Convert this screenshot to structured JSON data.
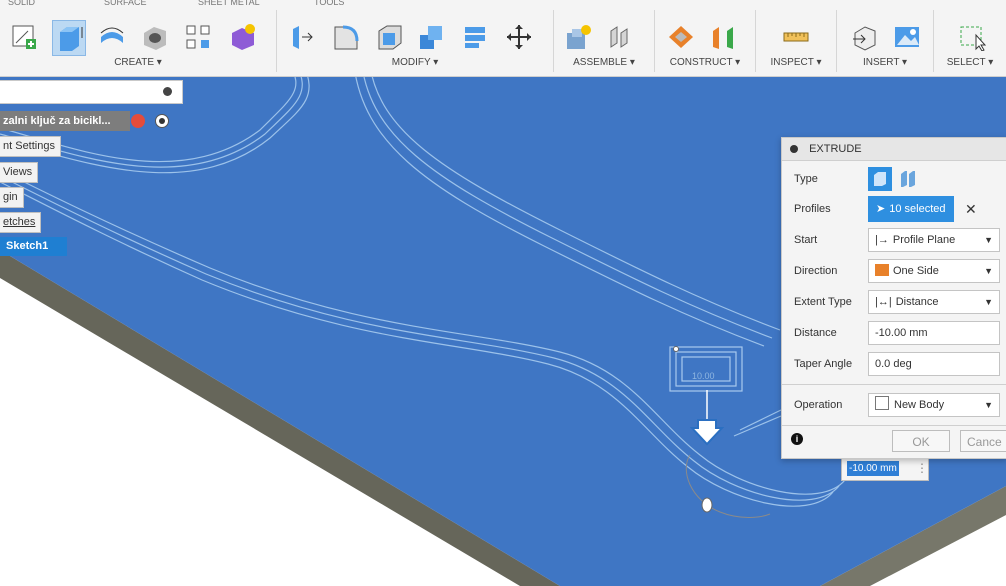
{
  "toolbar": {
    "tabs": [
      "SOLID",
      "SURFACE",
      "SHEET METAL",
      "TOOLS"
    ],
    "groups": {
      "create": "CREATE ▾",
      "modify": "MODIFY ▾",
      "assemble": "ASSEMBLE ▾",
      "construct": "CONSTRUCT ▾",
      "inspect": "INSPECT ▾",
      "insert": "INSERT ▾",
      "select": "SELECT ▾"
    }
  },
  "browser": {
    "document": "zalni ključ za bicikl...",
    "nodes": [
      "nt Settings",
      "Views",
      "gin",
      "etches",
      "Sketch1"
    ]
  },
  "extrude": {
    "title": "EXTRUDE",
    "labels": {
      "type": "Type",
      "profiles": "Profiles",
      "start": "Start",
      "direction": "Direction",
      "extent_type": "Extent Type",
      "distance": "Distance",
      "taper_angle": "Taper Angle",
      "operation": "Operation"
    },
    "values": {
      "profiles": "10 selected",
      "start": "Profile Plane",
      "direction": "One Side",
      "extent_type": "Distance",
      "distance": "-10.00 mm",
      "taper_angle": "0.0 deg",
      "operation": "New Body"
    },
    "ok": "OK",
    "cancel": "Cance"
  },
  "canvas": {
    "dimension_input": "-10.00 mm",
    "sketch_dim": "10.00"
  },
  "colors": {
    "face": "#3f76c4",
    "edge_dark": "#6d6d60",
    "accent": "#1f7fd2"
  }
}
